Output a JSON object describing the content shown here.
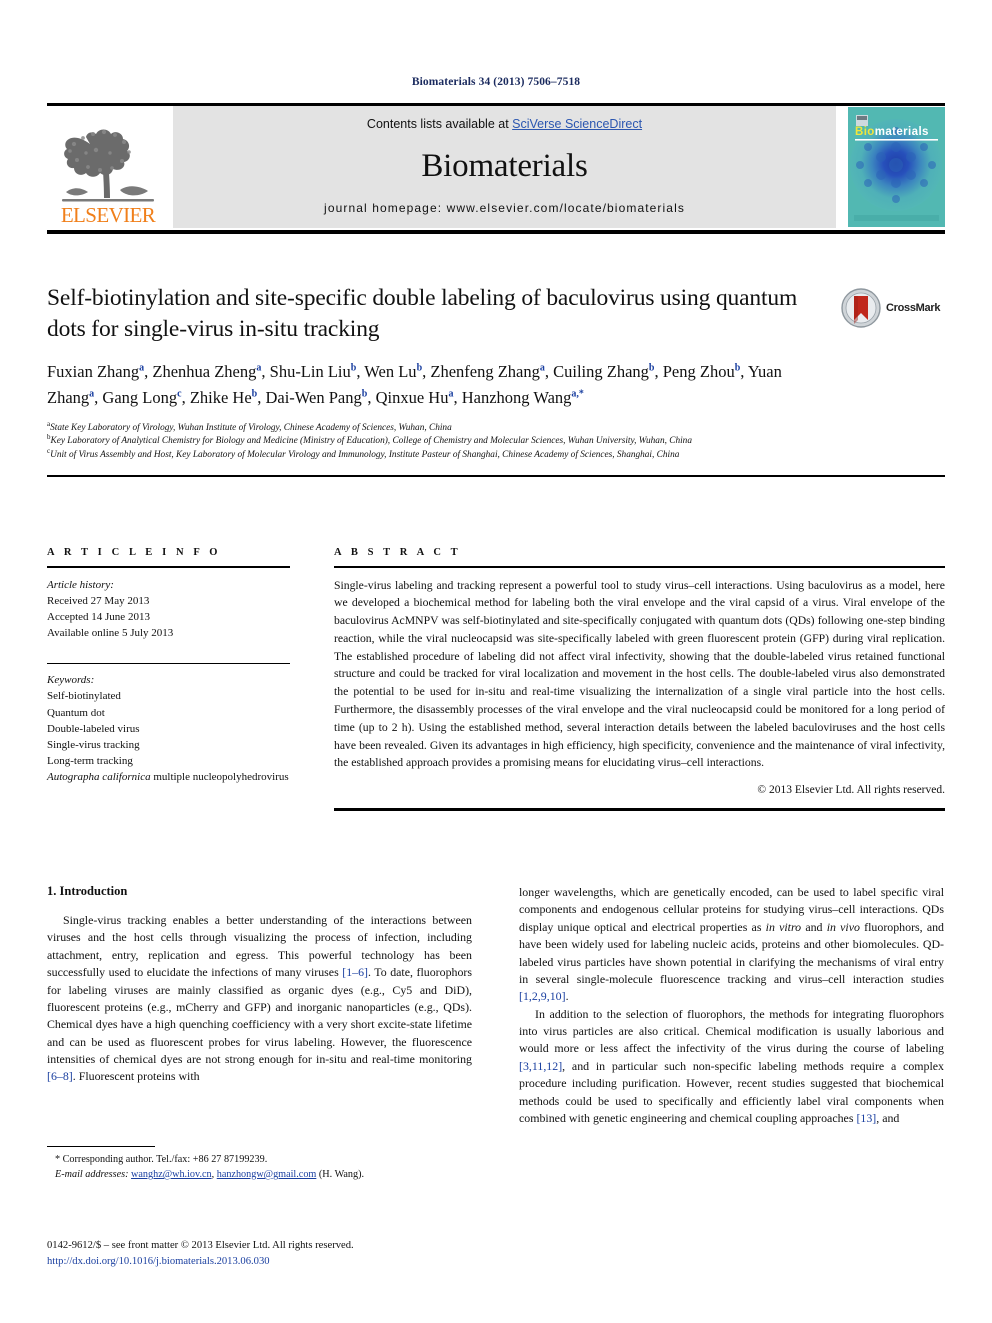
{
  "running_head": "Biomaterials 34 (2013) 7506–7518",
  "masthead": {
    "publisher_logo_text": "ELSEVIER",
    "contents_prefix": "Contents lists available at ",
    "contents_link": "SciVerse ScienceDirect",
    "journal_name": "Biomaterials",
    "homepage": "journal homepage: www.elsevier.com/locate/biomaterials",
    "cover_title_bio": "Bio",
    "cover_title_materials": "materials"
  },
  "article": {
    "title": "Self-biotinylation and site-specific double labeling of baculovirus using quantum dots for single-virus in-situ tracking",
    "crossmark_label": "CrossMark",
    "authors": [
      {
        "name": "Fuxian Zhang",
        "sup": "a",
        "sep": ", "
      },
      {
        "name": "Zhenhua Zheng",
        "sup": "a",
        "sep": ", "
      },
      {
        "name": "Shu-Lin Liu",
        "sup": "b",
        "sep": ", "
      },
      {
        "name": "Wen Lu",
        "sup": "b",
        "sep": ", "
      },
      {
        "name": "Zhenfeng Zhang",
        "sup": "a",
        "sep": ", "
      },
      {
        "name": "Cuiling Zhang",
        "sup": "b",
        "sep": ", "
      },
      {
        "name": "Peng Zhou",
        "sup": "b",
        "sep": ", "
      },
      {
        "name": "Yuan Zhang",
        "sup": "a",
        "sep": ", "
      },
      {
        "name": "Gang Long",
        "sup": "c",
        "sep": ", "
      },
      {
        "name": "Zhike He",
        "sup": "b",
        "sep": ", "
      },
      {
        "name": "Dai-Wen Pang",
        "sup": "b",
        "sep": ", "
      },
      {
        "name": "Qinxue Hu",
        "sup": "a",
        "sep": ", "
      },
      {
        "name": "Hanzhong Wang",
        "sup": "a,*",
        "sep": ""
      }
    ],
    "affiliations": [
      {
        "mark": "a",
        "text": "State Key Laboratory of Virology, Wuhan Institute of Virology, Chinese Academy of Sciences, Wuhan, China"
      },
      {
        "mark": "b",
        "text": "Key Laboratory of Analytical Chemistry for Biology and Medicine (Ministry of Education), College of Chemistry and Molecular Sciences, Wuhan University, Wuhan, China"
      },
      {
        "mark": "c",
        "text": "Unit of Virus Assembly and Host, Key Laboratory of Molecular Virology and Immunology, Institute Pasteur of Shanghai, Chinese Academy of Sciences, Shanghai, China"
      }
    ]
  },
  "article_info": {
    "heading": "A R T I C L E   I N F O",
    "history_label": "Article history:",
    "history": [
      "Received 27 May 2013",
      "Accepted 14 June 2013",
      "Available online 5 July 2013"
    ],
    "keywords_label": "Keywords:",
    "keywords": [
      "Self-biotinylated",
      "Quantum dot",
      "Double-labeled virus",
      "Single-virus tracking",
      "Long-term tracking"
    ],
    "keyword_italic_last": "Autographa californica",
    "keyword_last_rest": " multiple nucleopolyhedrovirus"
  },
  "abstract": {
    "heading": "A B S T R A C T",
    "text": "Single-virus labeling and tracking represent a powerful tool to study virus–cell interactions. Using baculovirus as a model, here we developed a biochemical method for labeling both the viral envelope and the viral capsid of a virus. Viral envelope of the baculovirus AcMNPV was self-biotinylated and site-specifically conjugated with quantum dots (QDs) following one-step binding reaction, while the viral nucleocapsid was site-specifically labeled with green fluorescent protein (GFP) during viral replication. The established procedure of labeling did not affect viral infectivity, showing that the double-labeled virus retained functional structure and could be tracked for viral localization and movement in the host cells. The double-labeled virus also demonstrated the potential to be used for in-situ and real-time visualizing the internalization of a single viral particle into the host cells. Furthermore, the disassembly processes of the viral envelope and the viral nucleocapsid could be monitored for a long period of time (up to 2 h). Using the established method, several interaction details between the labeled baculoviruses and the host cells have been revealed. Given its advantages in high efficiency, high specificity, convenience and the maintenance of viral infectivity, the established approach provides a promising means for elucidating virus–cell interactions.",
    "copyright": "© 2013 Elsevier Ltd. All rights reserved."
  },
  "introduction": {
    "heading": "1. Introduction",
    "left_para_1_a": "Single-virus tracking enables a better understanding of the interactions between viruses and the host cells through visualizing the process of infection, including attachment, entry, replication and egress. This powerful technology has been successfully used to elucidate the infections of many viruses ",
    "left_ref_1": "[1–6]",
    "left_para_1_b": ". To date, fluorophors for labeling viruses are mainly classified as organic dyes (e.g., Cy5 and DiD), fluorescent proteins (e.g., mCherry and GFP) and inorganic nanoparticles (e.g., QDs). Chemical dyes have a high quenching coefficiency with a very short excite-state lifetime and can be used as fluorescent probes for virus labeling. However, the fluorescence intensities of chemical dyes are not strong enough for in-situ and real-time monitoring ",
    "left_ref_2": "[6–8]",
    "left_para_1_c": ". Fluorescent proteins with",
    "right_para_1_a": "longer wavelengths, which are genetically encoded, can be used to label specific viral components and endogenous cellular proteins for studying virus–cell interactions. QDs display unique optical and electrical properties as ",
    "right_ital_1": "in vitro",
    "right_para_1_b": " and ",
    "right_ital_2": "in vivo",
    "right_para_1_c": " fluorophors, and have been widely used for labeling nucleic acids, proteins and other biomolecules. QD-labeled virus particles have shown potential in clarifying the mechanisms of viral entry in several single-molecule fluorescence tracking and virus–cell interaction studies ",
    "right_ref_1": "[1,2,9,10]",
    "right_para_1_d": ".",
    "right_para_2_a": "In addition to the selection of fluorophors, the methods for integrating fluorophors into virus particles are also critical. Chemical modification is usually laborious and would more or less affect the infectivity of the virus during the course of labeling ",
    "right_ref_2": "[3,11,12]",
    "right_para_2_b": ", and in particular such non-specific labeling methods require a complex procedure including purification. However, recent studies suggested that biochemical methods could be used to specifically and efficiently label viral components when combined with genetic engineering and chemical coupling approaches ",
    "right_ref_3": "[13]",
    "right_para_2_c": ", and"
  },
  "footnote": {
    "star": "*",
    "corresponding": " Corresponding author. Tel./fax: +86 27 87199239.",
    "email_label": "E-mail addresses:",
    "email_1": "wanghz@wh.iov.cn",
    "email_sep": ", ",
    "email_2": "hanzhongw@gmail.com",
    "email_tail": " (H. Wang)."
  },
  "imprint": {
    "line1": "0142-9612/$ – see front matter © 2013 Elsevier Ltd. All rights reserved.",
    "doi": "http://dx.doi.org/10.1016/j.biomaterials.2013.06.030"
  },
  "colors": {
    "link_blue": "#2b56b0",
    "ref_blue": "#1a3fa0",
    "elsevier_orange": "#F07F1A",
    "masthead_gray": "#e3e3e3",
    "cover_teal": "#4fb3ac",
    "crossmark_red": "#c0271c"
  }
}
